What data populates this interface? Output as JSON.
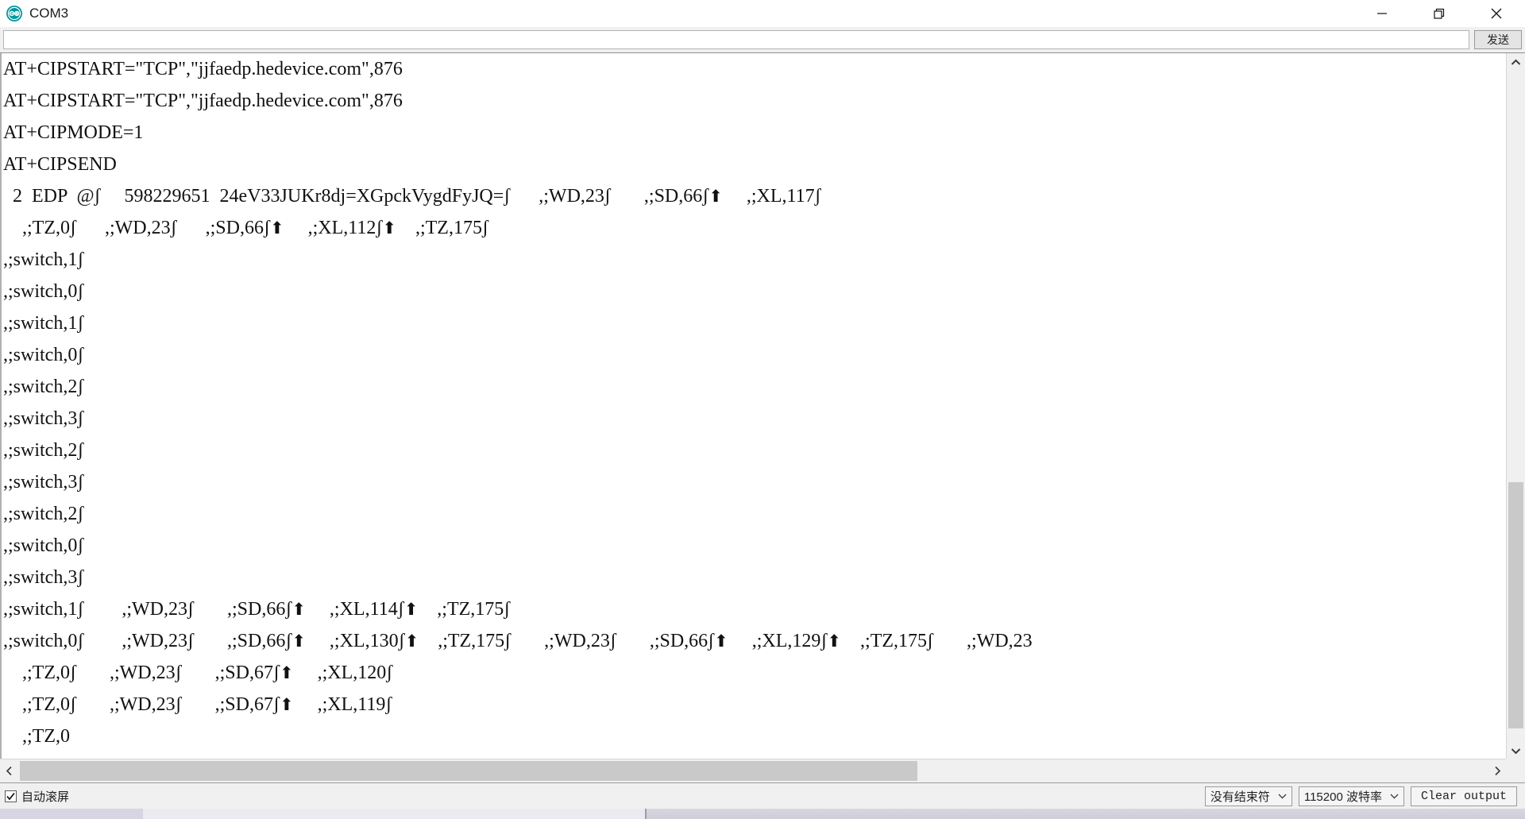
{
  "window": {
    "title": "COM3",
    "icon": "arduino-infinity-icon",
    "controls": {
      "minimize": "minimize-icon",
      "restore": "restore-icon",
      "close": "close-icon"
    }
  },
  "send_bar": {
    "input_value": "",
    "input_placeholder": "",
    "send_label": "发送"
  },
  "terminal": {
    "lines": [
      "AT+CIPSTART=\"TCP\",\"jjfaedp.hedevice.com\",876",
      "AT+CIPSTART=\"TCP\",\"jjfaedp.hedevice.com\",876",
      "AT+CIPMODE=1",
      "AT+CIPSEND",
      "  2  EDP  @ʃ     598229651  24eV33JUKr8dj=XGpckVygdFyJQ=ʃ      ,;WD,23ʃ       ,;SD,66ʃ↑     ,;XL,117ʃ",
      "    ,;TZ,0ʃ      ,;WD,23ʃ      ,;SD,66ʃ↑     ,;XL,112ʃ↑    ,;TZ,175ʃ",
      ",;switch,1ʃ",
      ",;switch,0ʃ",
      ",;switch,1ʃ",
      ",;switch,0ʃ",
      ",;switch,2ʃ",
      ",;switch,3ʃ",
      ",;switch,2ʃ",
      ",;switch,3ʃ",
      ",;switch,2ʃ",
      ",;switch,0ʃ",
      ",;switch,3ʃ",
      ",;switch,1ʃ        ,;WD,23ʃ       ,;SD,66ʃ↑     ,;XL,114ʃ↑    ,;TZ,175ʃ",
      ",;switch,0ʃ        ,;WD,23ʃ       ,;SD,66ʃ↑     ,;XL,130ʃ↑    ,;TZ,175ʃ       ,;WD,23ʃ       ,;SD,66ʃ↑     ,;XL,129ʃ↑    ,;TZ,175ʃ       ,;WD,23",
      "    ,;TZ,0ʃ       ,;WD,23ʃ       ,;SD,67ʃ↑     ,;XL,120ʃ",
      "    ,;TZ,0ʃ       ,;WD,23ʃ       ,;SD,67ʃ↑     ,;XL,119ʃ",
      "    ,;TZ,0"
    ]
  },
  "scrollbars": {
    "vertical_up": "chevron-up-icon",
    "vertical_down": "chevron-down-icon",
    "horizontal_left": "chevron-left-icon",
    "horizontal_right": "chevron-right-icon"
  },
  "status_bar": {
    "autoscroll_label": "自动滚屏",
    "autoscroll_checked": true,
    "line_ending": "没有结束符",
    "baud_rate": "115200 波特率",
    "clear_output_label": "Clear output"
  },
  "colors": {
    "accent": "#00979c",
    "window_bg": "#ffffff",
    "chrome_bg": "#f0f0f0",
    "scroll_thumb": "#c9c9c9",
    "text": "#111111"
  }
}
